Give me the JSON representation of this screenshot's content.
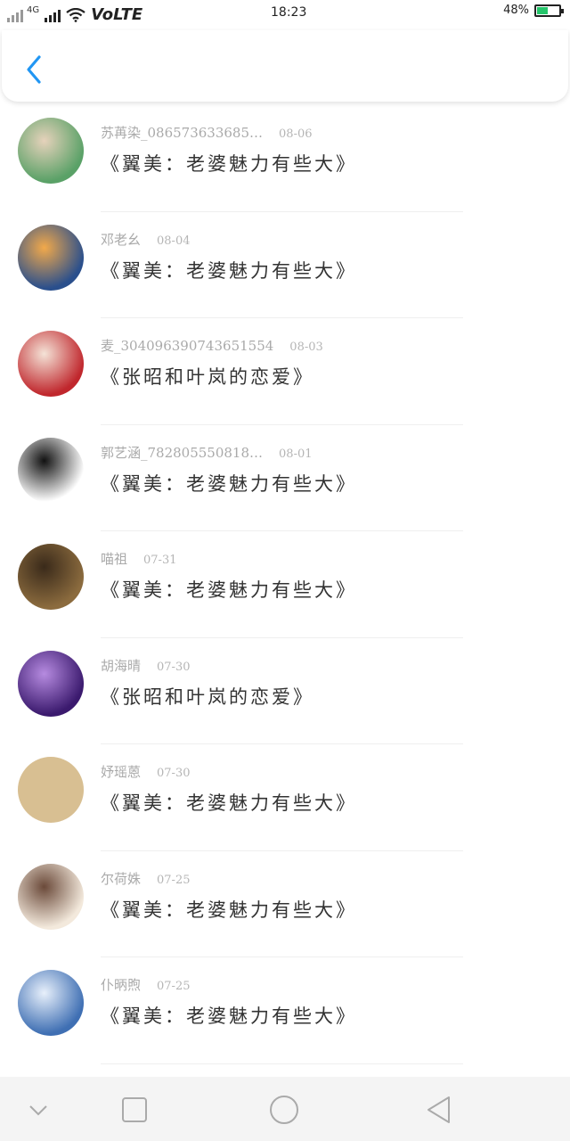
{
  "status_bar": {
    "network": "4G",
    "volte": "VoLTE",
    "time": "18:23",
    "battery": "48%",
    "battery_level": 0.48
  },
  "header": {
    "back_icon": "chevron-left-icon",
    "accent": "#2196f3"
  },
  "items": [
    {
      "name": "苏苒染_086573633685…",
      "date": "08-06",
      "title": "《翼美：老婆魅力有些大》",
      "avatar_colors": [
        "#5aa167",
        "#e6d2bb"
      ]
    },
    {
      "name": "邓老幺",
      "date": "08-04",
      "title": "《翼美：老婆魅力有些大》",
      "avatar_colors": [
        "#2a4f8c",
        "#f2a94a"
      ]
    },
    {
      "name": "麦_304096390743651554",
      "date": "08-03",
      "title": "《张昭和叶岚的恋爱》",
      "avatar_colors": [
        "#c0272d",
        "#f4e3d7"
      ]
    },
    {
      "name": "郭艺涵_782805550818…",
      "date": "08-01",
      "title": "《翼美：老婆魅力有些大》",
      "avatar_colors": [
        "#ffffff",
        "#111111"
      ]
    },
    {
      "name": "喵祖",
      "date": "07-31",
      "title": "《翼美：老婆魅力有些大》",
      "avatar_colors": [
        "#8b6b3e",
        "#3a2a1a"
      ]
    },
    {
      "name": "胡海晴",
      "date": "07-30",
      "title": "《张昭和叶岚的恋爱》",
      "avatar_colors": [
        "#3b1a6e",
        "#b68be0"
      ]
    },
    {
      "name": "妤瑶蒽",
      "date": "07-30",
      "title": "《翼美：老婆魅力有些大》",
      "avatar_colors": [
        "#d8bf92",
        "#d8bf92"
      ]
    },
    {
      "name": "尔荷姝",
      "date": "07-25",
      "title": "《翼美：老婆魅力有些大》",
      "avatar_colors": [
        "#f3e9dc",
        "#6b4a3a"
      ]
    },
    {
      "name": "仆昞煦",
      "date": "07-25",
      "title": "《翼美：老婆魅力有些大》",
      "avatar_colors": [
        "#3f6fb3",
        "#e8f0fb"
      ]
    }
  ],
  "nav_bar": {
    "icons": [
      "chevron-down-icon",
      "square-icon",
      "circle-icon",
      "triangle-back-icon"
    ]
  }
}
